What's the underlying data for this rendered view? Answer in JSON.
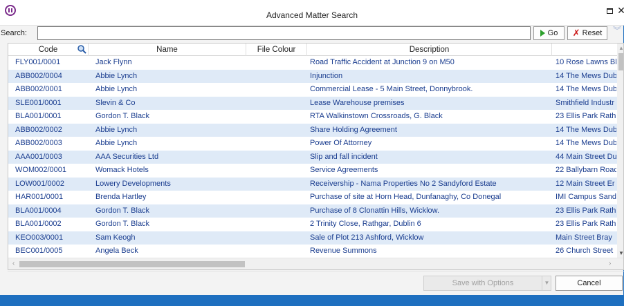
{
  "window": {
    "title": "Advanced Matter Search",
    "restore_glyph": "",
    "close_glyph": "✕"
  },
  "search": {
    "label": "Search:",
    "value": "",
    "placeholder": "",
    "go_label": "Go",
    "reset_label": "Reset"
  },
  "grid": {
    "columns": [
      "Code",
      "Name",
      "File Colour",
      "Description",
      ""
    ],
    "rows": [
      {
        "code": "FLY001/0001",
        "name": "Jack Flynn",
        "colour": "",
        "description": "Road Traffic Accident at Junction 9 on M50",
        "address": "10 Rose Lawns Bl"
      },
      {
        "code": "ABB002/0004",
        "name": "Abbie Lynch",
        "colour": "",
        "description": "Injunction",
        "address": "14 The Mews Dub"
      },
      {
        "code": "ABB002/0001",
        "name": "Abbie Lynch",
        "colour": "",
        "description": "Commercial Lease - 5 Main Street, Donnybrook.",
        "address": "14 The Mews Dub"
      },
      {
        "code": "SLE001/0001",
        "name": "Slevin & Co",
        "colour": "",
        "description": "Lease Warehouse premises",
        "address": "Smithfield Industr"
      },
      {
        "code": "BLA001/0001",
        "name": "Gordon T. Black",
        "colour": "",
        "description": "RTA Walkinstown Crossroads, G. Black",
        "address": "23 Ellis Park Rathi"
      },
      {
        "code": "ABB002/0002",
        "name": "Abbie Lynch",
        "colour": "",
        "description": "Share Holding Agreement",
        "address": "14 The Mews Dub"
      },
      {
        "code": "ABB002/0003",
        "name": "Abbie Lynch",
        "colour": "",
        "description": "Power Of Attorney",
        "address": "14 The Mews Dub"
      },
      {
        "code": "AAA001/0003",
        "name": "AAA Securities Ltd",
        "colour": "",
        "description": "Slip and fall incident",
        "address": "44 Main Street Du"
      },
      {
        "code": "WOM002/0001",
        "name": "Womack Hotels",
        "colour": "",
        "description": "Service Agreements",
        "address": "22 Ballybarn Roac"
      },
      {
        "code": "LOW001/0002",
        "name": "Lowery Developments",
        "colour": "",
        "description": "Receivership - Nama Properties No 2 Sandyford Estate",
        "address": "12 Main Street Er"
      },
      {
        "code": "HAR001/0001",
        "name": "Brenda Hartley",
        "colour": "",
        "description": "Purchase of site at Horn Head, Dunfanaghy, Co Donegal",
        "address": "IMI Campus Sand"
      },
      {
        "code": "BLA001/0004",
        "name": "Gordon T. Black",
        "colour": "",
        "description": "Purchase of 8 Clonattin Hills, Wicklow.",
        "address": "23 Ellis Park Rathi"
      },
      {
        "code": "BLA001/0002",
        "name": "Gordon T. Black",
        "colour": "",
        "description": "2 Trinity Close, Rathgar, Dublin 6",
        "address": "23 Ellis Park Rathi"
      },
      {
        "code": "KEO003/0001",
        "name": "Sam Keogh",
        "colour": "",
        "description": "Sale of Plot 213 Ashford, Wicklow",
        "address": "Main Street Bray"
      },
      {
        "code": "BEC001/0005",
        "name": "Angela Beck",
        "colour": "",
        "description": "Revenue Summons",
        "address": "26 Church Street"
      }
    ]
  },
  "footer": {
    "save_label": "Save with Options",
    "cancel_label": "Cancel"
  },
  "colors": {
    "accent": "#1e6fbf",
    "row_alt": "#dfeaf7",
    "link_text": "#1a3d8f"
  }
}
